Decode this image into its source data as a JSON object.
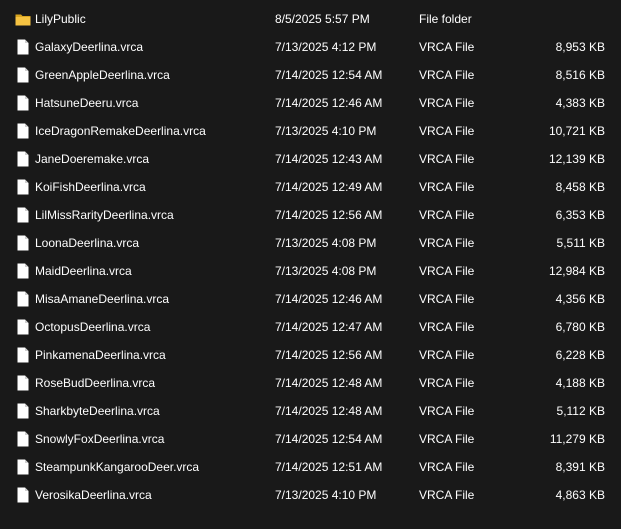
{
  "files": [
    {
      "name": "LilyPublic",
      "modified": "8/5/2025 5:57 PM",
      "type": "File folder",
      "size": "",
      "icon": "folder-icon"
    },
    {
      "name": "GalaxyDeerlina.vrca",
      "modified": "7/13/2025 4:12 PM",
      "type": "VRCA File",
      "size": "8,953 KB",
      "icon": "file-icon"
    },
    {
      "name": "GreenAppleDeerlina.vrca",
      "modified": "7/14/2025 12:54 AM",
      "type": "VRCA File",
      "size": "8,516 KB",
      "icon": "file-icon"
    },
    {
      "name": "HatsuneDeeru.vrca",
      "modified": "7/14/2025 12:46 AM",
      "type": "VRCA File",
      "size": "4,383 KB",
      "icon": "file-icon"
    },
    {
      "name": "IceDragonRemakeDeerlina.vrca",
      "modified": "7/13/2025 4:10 PM",
      "type": "VRCA File",
      "size": "10,721 KB",
      "icon": "file-icon"
    },
    {
      "name": "JaneDoeremake.vrca",
      "modified": "7/14/2025 12:43 AM",
      "type": "VRCA File",
      "size": "12,139 KB",
      "icon": "file-icon"
    },
    {
      "name": "KoiFishDeerlina.vrca",
      "modified": "7/14/2025 12:49 AM",
      "type": "VRCA File",
      "size": "8,458 KB",
      "icon": "file-icon"
    },
    {
      "name": "LilMissRarityDeerlina.vrca",
      "modified": "7/14/2025 12:56 AM",
      "type": "VRCA File",
      "size": "6,353 KB",
      "icon": "file-icon"
    },
    {
      "name": "LoonaDeerlina.vrca",
      "modified": "7/13/2025 4:08 PM",
      "type": "VRCA File",
      "size": "5,511 KB",
      "icon": "file-icon"
    },
    {
      "name": "MaidDeerlina.vrca",
      "modified": "7/13/2025 4:08 PM",
      "type": "VRCA File",
      "size": "12,984 KB",
      "icon": "file-icon"
    },
    {
      "name": "MisaAmaneDeerlina.vrca",
      "modified": "7/14/2025 12:46 AM",
      "type": "VRCA File",
      "size": "4,356 KB",
      "icon": "file-icon"
    },
    {
      "name": "OctopusDeerlina.vrca",
      "modified": "7/14/2025 12:47 AM",
      "type": "VRCA File",
      "size": "6,780 KB",
      "icon": "file-icon"
    },
    {
      "name": "PinkamenaDeerlina.vrca",
      "modified": "7/14/2025 12:56 AM",
      "type": "VRCA File",
      "size": "6,228 KB",
      "icon": "file-icon"
    },
    {
      "name": "RoseBudDeerlina.vrca",
      "modified": "7/14/2025 12:48 AM",
      "type": "VRCA File",
      "size": "4,188 KB",
      "icon": "file-icon"
    },
    {
      "name": "SharkbyteDeerlina.vrca",
      "modified": "7/14/2025 12:48 AM",
      "type": "VRCA File",
      "size": "5,112 KB",
      "icon": "file-icon"
    },
    {
      "name": "SnowlyFoxDeerlina.vrca",
      "modified": "7/14/2025 12:54 AM",
      "type": "VRCA File",
      "size": "11,279 KB",
      "icon": "file-icon"
    },
    {
      "name": "SteampunkKangarooDeer.vrca",
      "modified": "7/14/2025 12:51 AM",
      "type": "VRCA File",
      "size": "8,391 KB",
      "icon": "file-icon"
    },
    {
      "name": "VerosikaDeerlina.vrca",
      "modified": "7/13/2025 4:10 PM",
      "type": "VRCA File",
      "size": "4,863 KB",
      "icon": "file-icon"
    }
  ],
  "colors": {
    "background": "#191919",
    "text": "#ffffff",
    "folder": "#f6c342",
    "file": "#ffffff"
  }
}
